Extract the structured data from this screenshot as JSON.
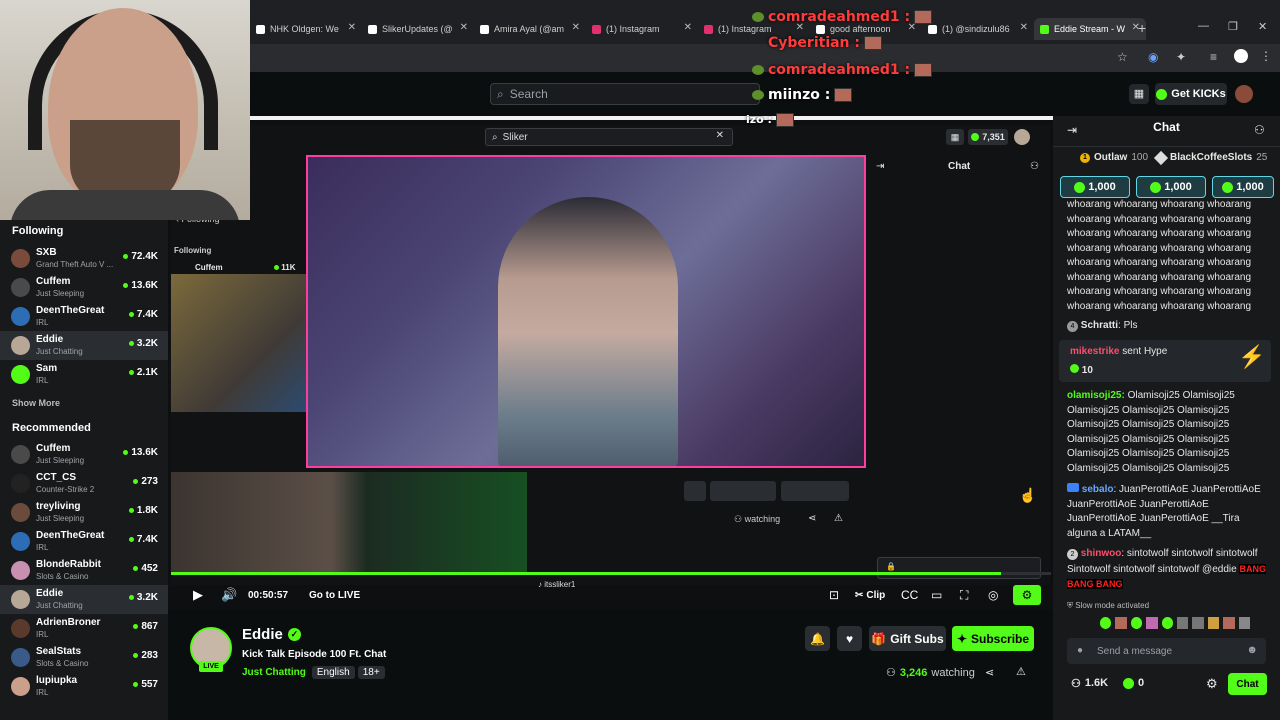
{
  "browser": {
    "tabs": [
      {
        "label": "NHK Oldgen: We",
        "icon_color": "#ffffff"
      },
      {
        "label": "SlikerUpdates (@",
        "icon_color": "#ffffff"
      },
      {
        "label": "Amira Ayal (@am",
        "icon_color": "#ffffff"
      },
      {
        "label": "(1) Instagram",
        "icon_color": "#e1306c"
      },
      {
        "label": "(1) Instagram",
        "icon_color": "#e1306c"
      },
      {
        "label": "good afternoon",
        "icon_color": "#ffffff"
      },
      {
        "label": "(1) @sindizulu86",
        "icon_color": "#ffffff"
      },
      {
        "label": "Eddie Stream - W",
        "icon_color": "#53fc18",
        "active": true
      }
    ]
  },
  "overlay_chat": [
    {
      "user": "comradeahmed1 :",
      "color": "#ff3b3b"
    },
    {
      "user": "Cyberitian :",
      "color": "#ff3b3b"
    },
    {
      "user": "comradeahmed1 :",
      "color": "#ff3b3b"
    },
    {
      "user": "miinzo :",
      "color": "#ffffff"
    },
    {
      "user": "izo :",
      "color": "#ffffff"
    }
  ],
  "header": {
    "search_placeholder": "Search",
    "get_kicks": "Get KICKs"
  },
  "inner_page": {
    "search_value": "Sliker",
    "kicks_count": "7,351",
    "chat_label": "Chat",
    "following_label": "Following",
    "pip_name": "Cuffem",
    "pip_viewers": "11K",
    "pip2_name": "itssliker1",
    "watching": "watching"
  },
  "sidebar": {
    "following_title": "Following",
    "following": [
      {
        "name": "SXB",
        "sub": "Grand Theft Auto V ...",
        "viewers": "72.4K",
        "color": "#7a4b3a"
      },
      {
        "name": "Cuffem",
        "sub": "Just Sleeping",
        "viewers": "13.6K",
        "color": "#4a4a4a"
      },
      {
        "name": "DeenTheGreat",
        "sub": "IRL",
        "viewers": "7.4K",
        "color": "#2d6db5"
      },
      {
        "name": "Eddie",
        "sub": "Just Chatting",
        "viewers": "3.2K",
        "color": "#b7a796",
        "selected": true
      },
      {
        "name": "Sam",
        "sub": "IRL",
        "viewers": "2.1K",
        "color": "#53fc18"
      }
    ],
    "show_more": "Show More",
    "recommended_title": "Recommended",
    "recommended": [
      {
        "name": "Cuffem",
        "sub": "Just Sleeping",
        "viewers": "13.6K",
        "color": "#4a4a4a"
      },
      {
        "name": "CCT_CS",
        "sub": "Counter-Strike 2",
        "viewers": "273",
        "color": "#222222"
      },
      {
        "name": "treyliving",
        "sub": "Just Sleeping",
        "viewers": "1.8K",
        "color": "#6b4b3b"
      },
      {
        "name": "DeenTheGreat",
        "sub": "IRL",
        "viewers": "7.4K",
        "color": "#2d6db5"
      },
      {
        "name": "BlondeRabbit",
        "sub": "Slots & Casino",
        "viewers": "452",
        "color": "#c98fb0"
      },
      {
        "name": "Eddie",
        "sub": "Just Chatting",
        "viewers": "3.2K",
        "color": "#b7a796",
        "selected": true
      },
      {
        "name": "AdrienBroner",
        "sub": "IRL",
        "viewers": "867",
        "color": "#5a3a2a"
      },
      {
        "name": "SealStats",
        "sub": "Slots & Casino",
        "viewers": "283",
        "color": "#3a5a8a"
      },
      {
        "name": "lupiupka",
        "sub": "IRL",
        "viewers": "557",
        "color": "#caa08a"
      }
    ]
  },
  "player": {
    "time": "00:50:57",
    "go_live": "Go to LIVE",
    "clip": "Clip",
    "progress_fraction": 0.943
  },
  "stream_info": {
    "streamer": "Eddie",
    "live": "LIVE",
    "title": "Kick Talk Episode 100 Ft. Chat",
    "category": "Just Chatting",
    "tags": [
      "English",
      "18+"
    ],
    "gift_subs": "Gift Subs",
    "subscribe": "Subscribe",
    "viewers": "3,246",
    "watching": "watching"
  },
  "chat": {
    "title": "Chat",
    "leaders": [
      {
        "rank": "1",
        "name": "Outlaw",
        "value": "100"
      },
      {
        "rank": "",
        "name": "BlackCoffeeSlots",
        "value": "25"
      }
    ],
    "kick_amounts": [
      "1,000",
      "1,000",
      "1,000"
    ],
    "spam_text": "whoarang whoarang whoarang whoarang whoarang whoarang whoarang whoarang whoarang whoarang whoarang whoarang whoarang whoarang whoarang whoarang whoarang whoarang whoarang whoarang whoarang whoarang whoarang whoarang whoarang whoarang whoarang whoarang whoarang whoarang whoarang whoarang whoarang whoarang whoarang whoarang whoarang whoarang whoarang whoarang whoarang whoarang whoarang whoarang whoarang whoarang whoarang whoarang",
    "schratti": {
      "user": "Schratti",
      "text": "Pls"
    },
    "hype": {
      "user": "mikestrike",
      "text": "sent Hype",
      "amount": "10"
    },
    "olami": {
      "user": "olamisoji25:",
      "text": "Olamisoji25 Olamisoji25 Olamisoji25 Olamisoji25 Olamisoji25 Olamisoji25 Olamisoji25 Olamisoji25 Olamisoji25 Olamisoji25 Olamisoji25 Olamisoji25 Olamisoji25 Olamisoji25 Olamisoji25 Olamisoji25 Olamisoji25 Olamisoji25"
    },
    "sebalo": {
      "user": "sebalo",
      "text": ": JuanPerottiAoE JuanPerottiAoE JuanPerottiAoE JuanPerottiAoE JuanPerottiAoE JuanPerottiAoE __Tira alguna a LATAM__"
    },
    "shinwoo": {
      "user": "shinwoo",
      "text": ": sintotwolf sintotwolf sintotwolf Sintotwolf sintotwolf sintotwolf @eddie",
      "emote": "BANG BANG BANG"
    },
    "slow_mode": "Slow mode activated",
    "input_placeholder": "Send a message",
    "followers": "1.6K",
    "kicks": "0",
    "send_label": "Chat"
  },
  "colors": {
    "accent": "#53fc18",
    "background": "#0b0e0f",
    "panel": "#18191b"
  }
}
